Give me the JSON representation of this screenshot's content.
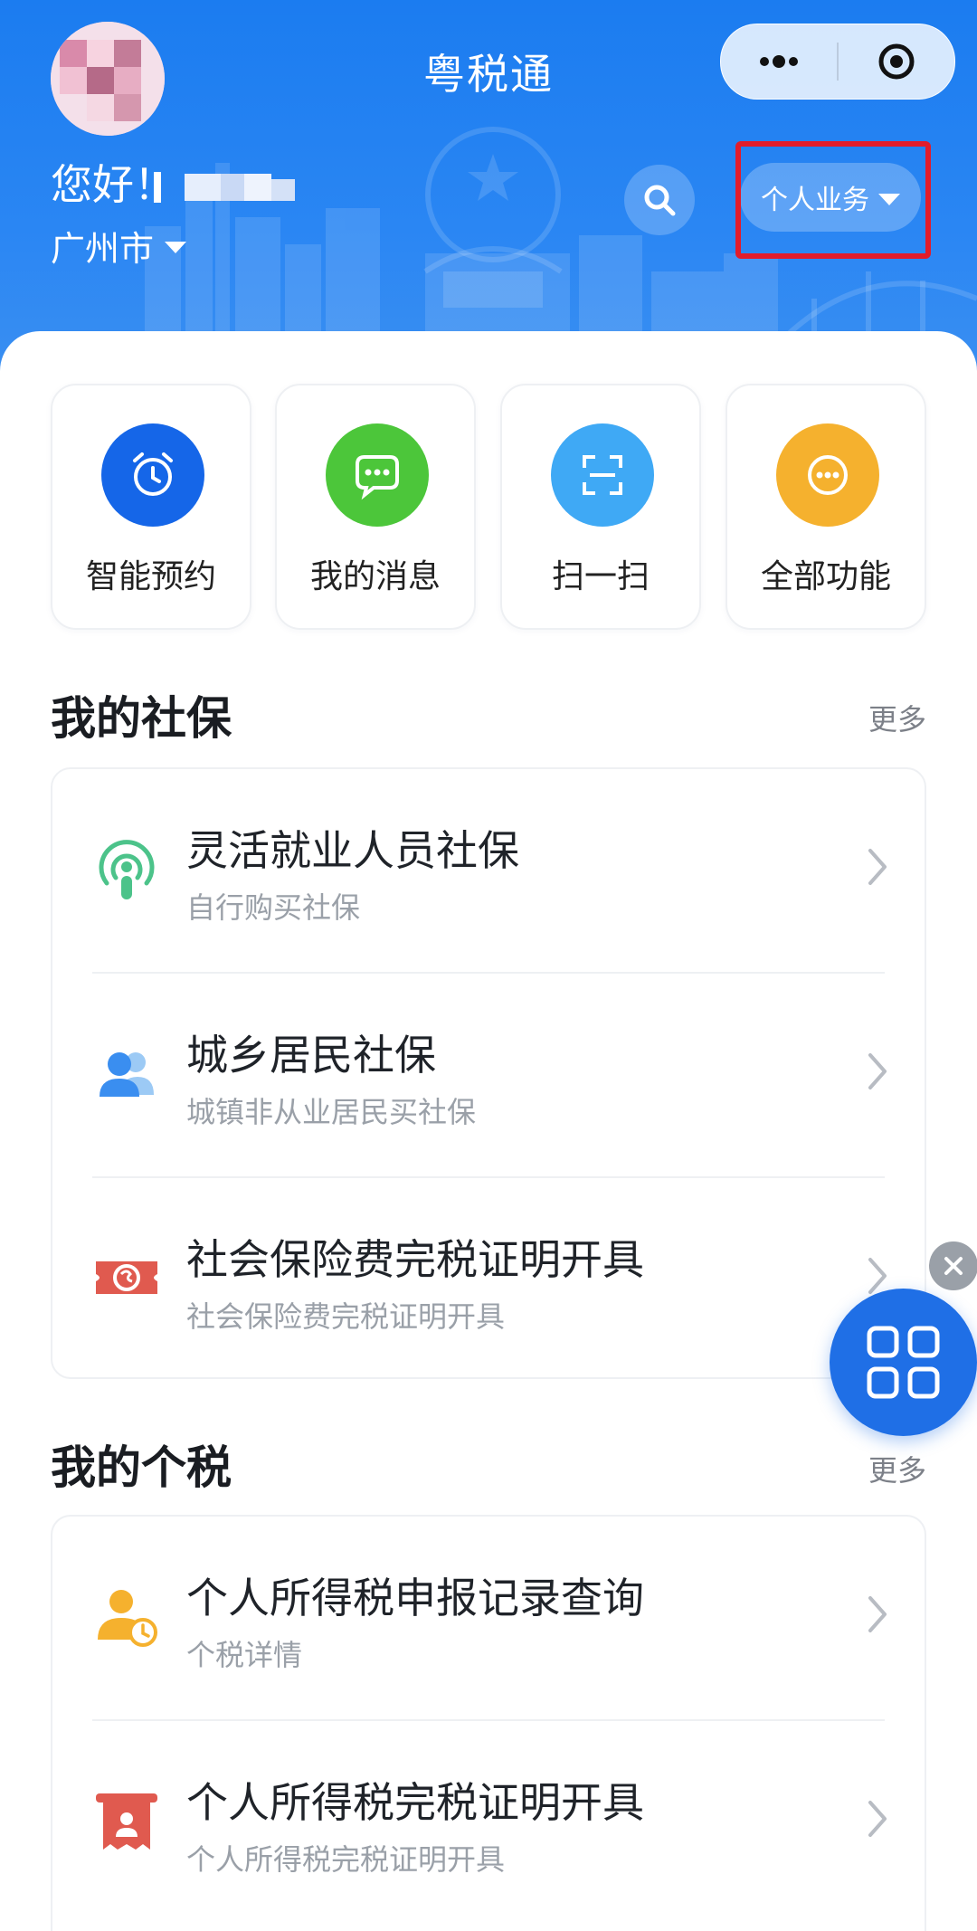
{
  "header": {
    "app_title": "粤税通",
    "greeting": "您好！",
    "city": "广州市",
    "business_selector": "个人业务",
    "accent_color": "#1b7cf0"
  },
  "quick_actions": [
    {
      "label": "智能预约",
      "icon": "alarm-clock-icon",
      "color": "#1566e8"
    },
    {
      "label": "我的消息",
      "icon": "chat-bubble-icon",
      "color": "#4cc63a"
    },
    {
      "label": "扫一扫",
      "icon": "scan-icon",
      "color": "#3fa9f5"
    },
    {
      "label": "全部功能",
      "icon": "more-dots-icon",
      "color": "#f5b12e"
    }
  ],
  "social_security": {
    "title": "我的社保",
    "more": "更多",
    "items": [
      {
        "title": "灵活就业人员社保",
        "subtitle": "自行购买社保",
        "icon": "broadcast-person-icon"
      },
      {
        "title": "城乡居民社保",
        "subtitle": "城镇非从业居民买社保",
        "icon": "users-icon"
      },
      {
        "title": "社会保险费完税证明开具",
        "subtitle": "社会保险费完税证明开具",
        "icon": "si-card-icon"
      }
    ]
  },
  "personal_tax": {
    "title": "我的个税",
    "more": "更多",
    "items": [
      {
        "title": "个人所得税申报记录查询",
        "subtitle": "个税详情",
        "icon": "person-clock-icon"
      },
      {
        "title": "个人所得税完税证明开具",
        "subtitle": "个人所得税完税证明开具",
        "icon": "receipt-person-icon"
      }
    ]
  }
}
